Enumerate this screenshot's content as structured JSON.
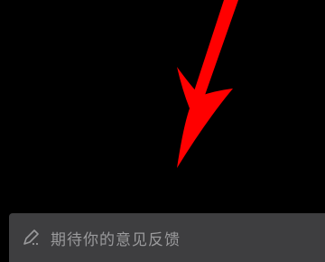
{
  "feedback": {
    "placeholder": "期待你的意见反馈",
    "icon": "pencil-icon"
  },
  "annotation": {
    "type": "arrow",
    "color": "#ff0000"
  },
  "colors": {
    "background": "#000000",
    "bar_background": "#3e3e40",
    "placeholder_text": "#9a9a9c"
  }
}
